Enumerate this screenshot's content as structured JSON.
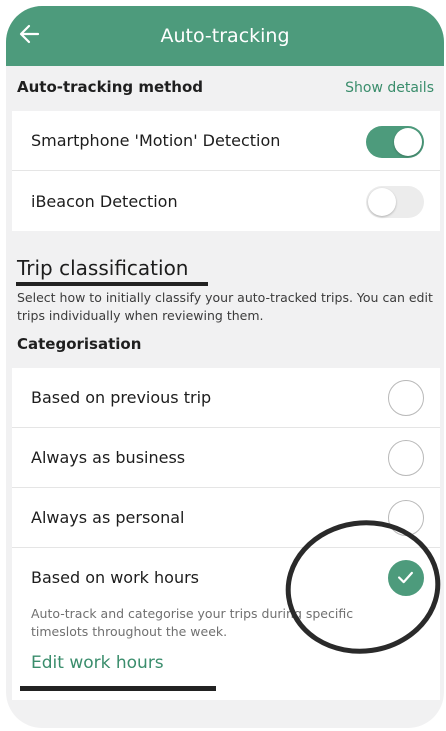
{
  "header": {
    "title": "Auto-tracking",
    "back_icon": "arrow-left-icon",
    "color": "#4d9b7c"
  },
  "method": {
    "label": "Auto-tracking method",
    "show_details": "Show details",
    "items": [
      {
        "label": "Smartphone 'Motion' Detection",
        "on": true
      },
      {
        "label": "iBeacon Detection",
        "on": false
      }
    ]
  },
  "classification": {
    "heading": "Trip classification",
    "description": "Select how to initially classify your auto-tracked trips. You can edit trips individually when reviewing them.",
    "categorisation_label": "Categorisation",
    "options": [
      {
        "label": "Based on previous trip",
        "selected": false
      },
      {
        "label": "Always as business",
        "selected": false
      },
      {
        "label": "Always as personal",
        "selected": false
      },
      {
        "label": "Based on work hours",
        "selected": true
      }
    ],
    "work_hours_description": "Auto-track and categorise your trips during specific timeslots throughout the week.",
    "edit_link": "Edit work hours"
  },
  "annotations": {
    "color": "#2a2a2a"
  }
}
